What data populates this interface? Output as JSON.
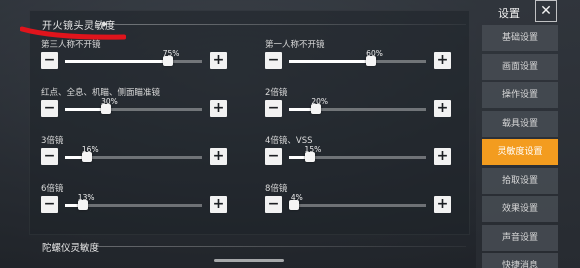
{
  "section_title": "开火镜头灵敏度",
  "gyro_section_title": "陀螺仪灵敏度",
  "settings": [
    {
      "label": "第三人称不开镜",
      "percent": "75%",
      "value": 0.75
    },
    {
      "label": "第一人称不开镜",
      "percent": "60%",
      "value": 0.6
    },
    {
      "label": "红点、全息、机瞄、侧面瞄准镜",
      "percent": "30%",
      "value": 0.3
    },
    {
      "label": "2倍镜",
      "percent": "20%",
      "value": 0.2
    },
    {
      "label": "3倍镜",
      "percent": "16%",
      "value": 0.16
    },
    {
      "label": "4倍镜、VSS",
      "percent": "15%",
      "value": 0.15
    },
    {
      "label": "6倍镜",
      "percent": "13%",
      "value": 0.13
    },
    {
      "label": "8倍镜",
      "percent": "4%",
      "value": 0.04
    }
  ],
  "buttons": {
    "minus": "−",
    "plus": "+"
  },
  "nav": {
    "title": "设置",
    "close": "✕",
    "items": [
      "基础设置",
      "画面设置",
      "操作设置",
      "载具设置",
      "灵敏度设置",
      "拾取设置",
      "效果设置",
      "声音设置",
      "快捷消息"
    ],
    "active_index": 4
  },
  "colors": {
    "accent": "#f39c1f",
    "annotation": "#e0141c"
  }
}
